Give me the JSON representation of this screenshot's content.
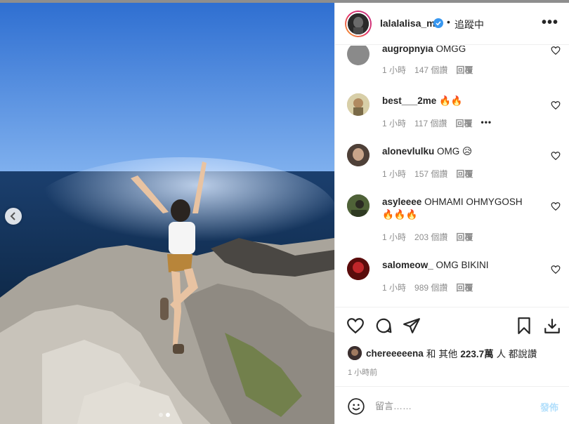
{
  "post": {
    "username": "lalalalisa_m",
    "separator": "•",
    "follow_status": "追蹤中",
    "more_label": "•••"
  },
  "comments": [
    {
      "user": "augropnyia",
      "text": "OMGG",
      "time": "1 小時",
      "likes": "147 個讚",
      "reply": "回覆",
      "avatar_color": "#8a8a8a"
    },
    {
      "user": "best___2me",
      "text": "🔥🔥",
      "time": "1 小時",
      "likes": "117 個讚",
      "reply": "回覆",
      "extra": "•••",
      "avatar_color": "#c9b08a"
    },
    {
      "user": "alonevlulku",
      "text": "OMG 😥",
      "time": "1 小時",
      "likes": "157 個讚",
      "reply": "回覆",
      "avatar_color": "#6b5a4e"
    },
    {
      "user": "asyleeee",
      "text": "OHMAMI OHMYGOSH 🔥🔥🔥",
      "time": "1 小時",
      "likes": "203 個讚",
      "reply": "回覆",
      "avatar_color": "#3d4a2e"
    },
    {
      "user": "salomeow_",
      "text": "OMG BIKINI",
      "time": "1 小時",
      "likes": "989 個讚",
      "reply": "回覆",
      "avatar_color": "#8b1a1a"
    }
  ],
  "likes": {
    "user": "chereeeeena",
    "and": "和",
    "others": "其他",
    "count": "223.7萬",
    "suffix": "人 都說讚"
  },
  "time_ago": "1 小時前",
  "add_comment": {
    "placeholder": "留言……",
    "post_label": "發佈"
  },
  "carousel": {
    "total": 2,
    "active": 2
  }
}
